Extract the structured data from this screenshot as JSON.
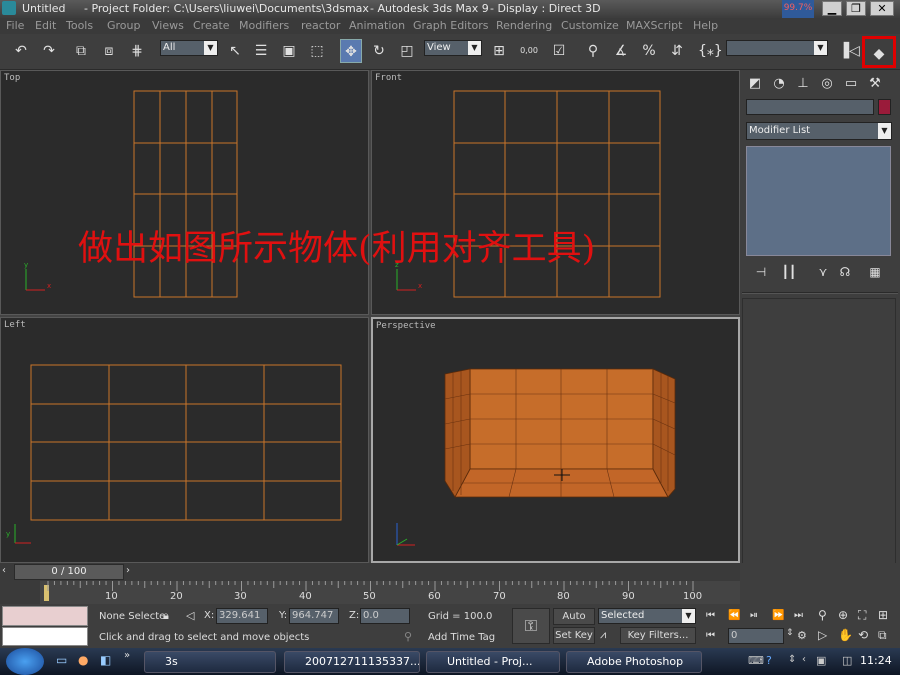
{
  "titlebar": {
    "app_title": "Untitled",
    "project_folder": "- Project Folder: C:\\Users\\liuwei\\Documents\\3dsmax",
    "app_name": "- Autodesk 3ds Max 9",
    "display": "- Display : Direct 3D",
    "meter": "99.7%"
  },
  "menu": [
    "File",
    "Edit",
    "Tools",
    "Group",
    "Views",
    "Create",
    "Modifiers",
    "reactor",
    "Animation",
    "Graph Editors",
    "Rendering",
    "Customize",
    "MAXScript",
    "Help"
  ],
  "toolbar": {
    "selection_filter": "All",
    "ref_coord": "View",
    "snap_value": "0,00"
  },
  "viewports": {
    "top": {
      "label": "Top"
    },
    "front": {
      "label": "Front"
    },
    "left": {
      "label": "Left"
    },
    "perspective": {
      "label": "Perspective"
    }
  },
  "overlay_text": "做出如图所示物体(利用对齐工具)",
  "command_panel": {
    "modifier_list": "Modifier List"
  },
  "timeline": {
    "frame": "0 / 100",
    "ticks": [
      "10",
      "20",
      "30",
      "40",
      "50",
      "60",
      "70",
      "80",
      "90",
      "100"
    ]
  },
  "status": {
    "selection": "None Selecte",
    "x_label": "X:",
    "x_value": "329.641",
    "y_label": "Y:",
    "y_value": "964.747",
    "z_label": "Z:",
    "z_value": "0.0",
    "grid": "Grid = 100.0",
    "auto_key": "Auto Key",
    "selected": "Selected",
    "set_key": "Set Key",
    "key_filters": "Key Filters...",
    "add_time_tag": "Add Time Tag",
    "prompt": "Click and drag to select and move objects",
    "current_frame": "0"
  },
  "taskbar": {
    "items": [
      "3s",
      "200712711135337...",
      "Untitled    - Proj...",
      "Adobe Photoshop"
    ],
    "clock": "11:24"
  },
  "colors": {
    "grid_line": "#c8742a",
    "object_fill": "#c66d2a",
    "overlay_text": "#e01010",
    "highlight_border": "#e00000"
  }
}
